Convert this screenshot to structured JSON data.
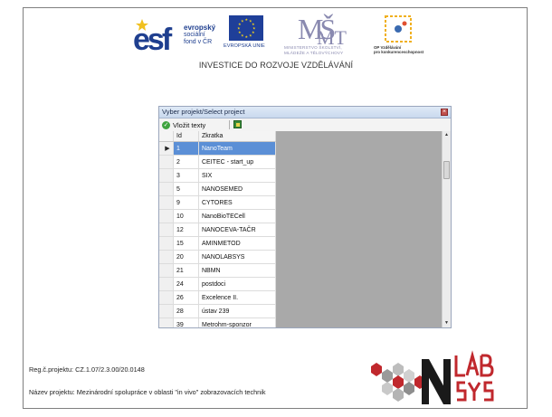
{
  "header": {
    "esf": {
      "line1": "evropský",
      "line2": "sociální",
      "line3": "fond v ČR"
    },
    "eu_label": "EVROPSKÁ UNIE",
    "msmt": {
      "line1": "MINISTERSTVO ŠKOLSTVÍ,",
      "line2": "MLÁDEŽE A TĚLOVÝCHOVY"
    },
    "op": {
      "line1": "OP Vzdělávání",
      "line2": "pro konkurenceschopnost"
    },
    "investice": "INVESTICE DO ROZVOJE VZDĚLÁVÁNÍ"
  },
  "dialog": {
    "title": "Vyber projekt/Select project",
    "close_glyph": "×",
    "toolbar": {
      "insert_label": "Vložit texty"
    },
    "columns": {
      "id": "Id",
      "zkratka": "Zkratka"
    },
    "current_row_marker": "▶",
    "rows": [
      {
        "id": "1",
        "zkratka": "NanoTeam"
      },
      {
        "id": "2",
        "zkratka": "CEITEC - start_up"
      },
      {
        "id": "3",
        "zkratka": "SIX"
      },
      {
        "id": "5",
        "zkratka": "NANOSEMED"
      },
      {
        "id": "9",
        "zkratka": "CYTORES"
      },
      {
        "id": "10",
        "zkratka": "NanoBioTECell"
      },
      {
        "id": "12",
        "zkratka": "NANOCEVA-TAČR"
      },
      {
        "id": "15",
        "zkratka": "AMINMETOD"
      },
      {
        "id": "20",
        "zkratka": "NANOLABSYS"
      },
      {
        "id": "21",
        "zkratka": "NBMN"
      },
      {
        "id": "24",
        "zkratka": "postdoci"
      },
      {
        "id": "26",
        "zkratka": "Excelence II."
      },
      {
        "id": "28",
        "zkratka": "ústav 239"
      },
      {
        "id": "39",
        "zkratka": "Metrohm-sponzor"
      }
    ],
    "selected_row": "1",
    "scroll": {
      "up": "▲",
      "down": "▼"
    }
  },
  "footer": {
    "reg": "Reg.č.projektu: CZ.1.07/2.3.00/20.0148",
    "nazev": "Název projektu: Mezinárodní spolupráce v oblasti \"in vivo\" zobrazovacích technik"
  },
  "colors": {
    "selection": "#5b8fd6",
    "esf_blue": "#1f3f8f",
    "labsys_red": "#c0282d"
  }
}
